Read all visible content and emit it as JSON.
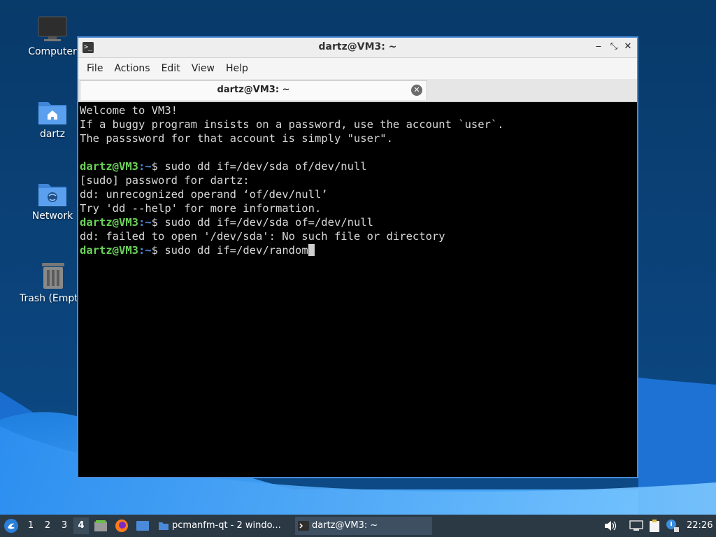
{
  "desktop": {
    "icons": [
      {
        "label": "Computer",
        "icon": "computer-icon"
      },
      {
        "label": "dartz",
        "icon": "home-folder-icon"
      },
      {
        "label": "Network",
        "icon": "network-folder-icon"
      },
      {
        "label": "Trash (Empty)",
        "icon": "trash-icon"
      }
    ]
  },
  "window": {
    "title": "dartz@VM3: ~",
    "menu": [
      "File",
      "Actions",
      "Edit",
      "View",
      "Help"
    ],
    "tab_label": "dartz@VM3: ~",
    "buttons": {
      "minimize": "‒",
      "maximize": "⤡",
      "close": "✕"
    }
  },
  "terminal": {
    "prompt_user": "dartz@VM3",
    "prompt_path": ":~",
    "prompt_symbol": "$",
    "lines": [
      "Welcome to VM3!",
      "If a buggy program insists on a password, use the account `user`.",
      "The passsword for that account is simply \"user\".",
      "",
      {
        "cmd": " sudo dd if=/dev/sda of/dev/null"
      },
      "[sudo] password for dartz:",
      "dd: unrecognized operand ‘of/dev/null’",
      "Try 'dd --help' for more information.",
      {
        "cmd": " sudo dd if=/dev/sda of=/dev/null"
      },
      "dd: failed to open '/dev/sda': No such file or directory",
      {
        "cmd": " sudo dd if=/dev/random",
        "cursor": true
      }
    ]
  },
  "taskbar": {
    "workspaces": [
      "1",
      "2",
      "3",
      "4"
    ],
    "active_workspace": "4",
    "tasks": [
      {
        "label": "pcmanfm-qt - 2 windo...",
        "icon": "folder-icon"
      },
      {
        "label": "dartz@VM3: ~",
        "icon": "terminal-icon",
        "active": true
      }
    ],
    "clock": "22:26"
  },
  "colors": {
    "accent": "#4a8ad8",
    "prompt_user": "#6bd35a",
    "taskbar_bg": "#2b3945"
  }
}
